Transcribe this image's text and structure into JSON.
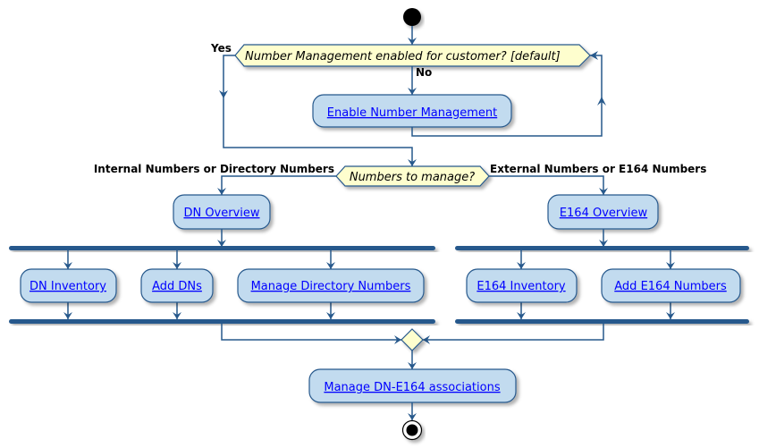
{
  "colors": {
    "line": "#27598c",
    "activity_fill": "#c2dbef",
    "decision_fill": "#fefece",
    "link": "#0000ff"
  },
  "decision1": {
    "question": "Number Management enabled for customer? [default]",
    "yes": "Yes",
    "no": "No"
  },
  "enable": "Enable Number Management",
  "decision2": {
    "question": "Numbers to manage?",
    "left": "Internal Numbers or Directory Numbers",
    "right": "External Numbers or E164 Numbers"
  },
  "dn_overview": "DN Overview",
  "dn_items": [
    "DN Inventory",
    "Add DNs",
    "Manage Directory Numbers"
  ],
  "e164_overview": "E164 Overview",
  "e164_items": [
    "E164 Inventory",
    "Add E164 Numbers"
  ],
  "final": "Manage DN-E164 associations"
}
